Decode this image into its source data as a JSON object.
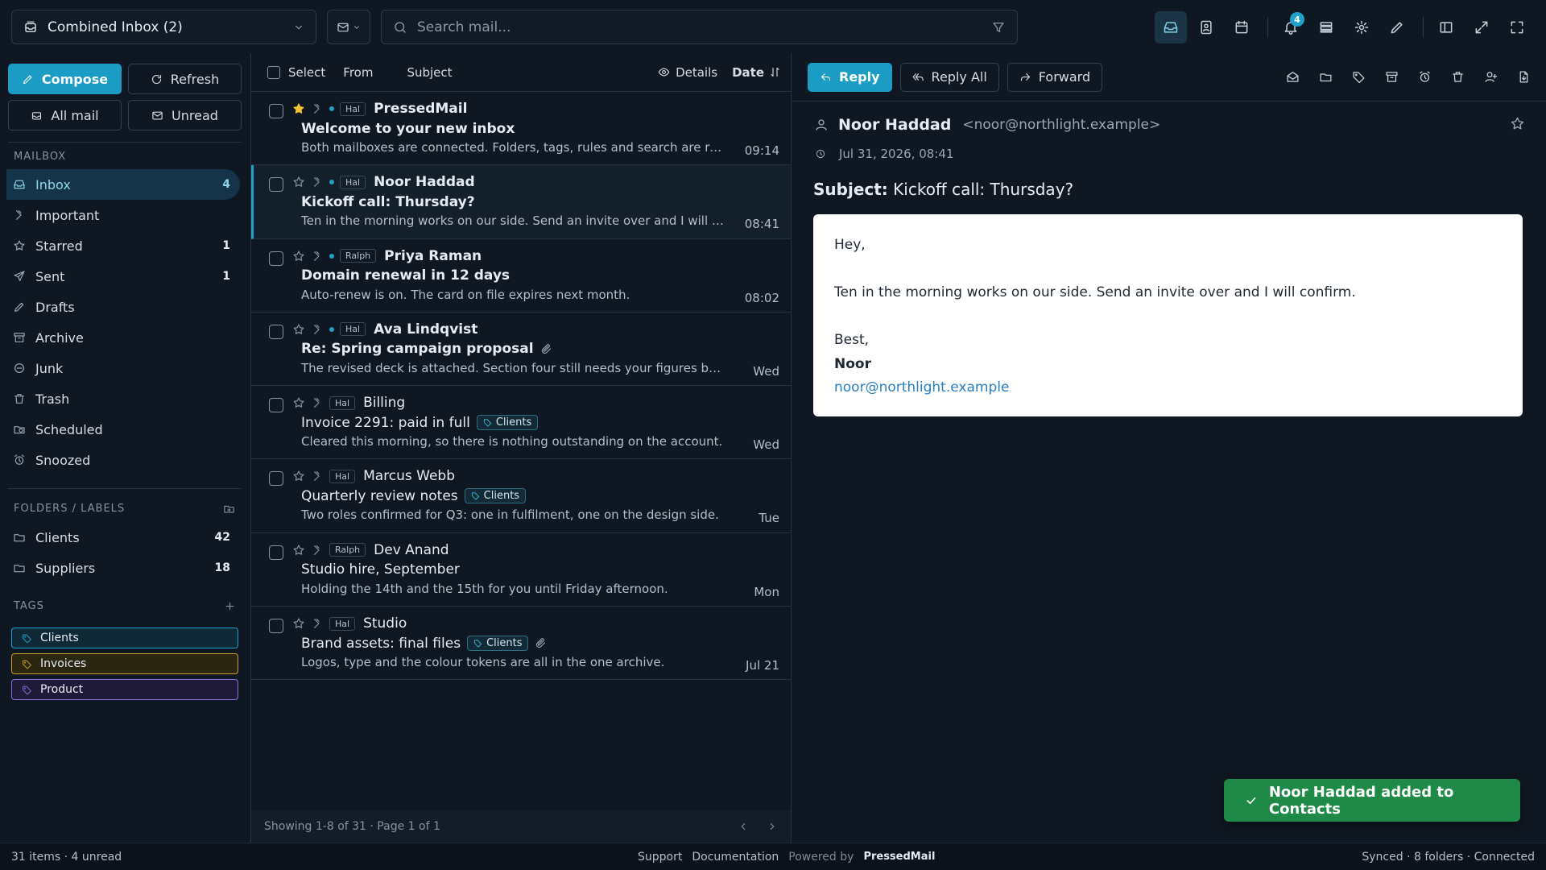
{
  "topbar": {
    "account_label": "Combined Inbox (2)",
    "search_placeholder": "Search mail...",
    "notification_count": "4"
  },
  "sidebar": {
    "compose_label": "Compose",
    "refresh_label": "Refresh",
    "all_mail_label": "All mail",
    "unread_label": "Unread",
    "mailbox_heading": "MAILBOX",
    "mailbox": [
      {
        "label": "Inbox",
        "count": "4",
        "icon": "inbox-icon"
      },
      {
        "label": "Important",
        "count": "",
        "icon": "important-icon"
      },
      {
        "label": "Starred",
        "count": "1",
        "icon": "star-icon"
      },
      {
        "label": "Sent",
        "count": "1",
        "icon": "send-icon"
      },
      {
        "label": "Drafts",
        "count": "",
        "icon": "pencil-icon"
      },
      {
        "label": "Archive",
        "count": "",
        "icon": "archive-icon"
      },
      {
        "label": "Junk",
        "count": "",
        "icon": "junk-icon"
      },
      {
        "label": "Trash",
        "count": "",
        "icon": "trash-icon"
      },
      {
        "label": "Scheduled",
        "count": "",
        "icon": "folder-clock-icon"
      },
      {
        "label": "Snoozed",
        "count": "",
        "icon": "alarm-icon"
      }
    ],
    "folders_heading": "FOLDERS / LABELS",
    "folders": [
      {
        "label": "Clients",
        "count": "42"
      },
      {
        "label": "Suppliers",
        "count": "18"
      }
    ],
    "tags_heading": "TAGS",
    "tags": [
      {
        "label": "Clients",
        "color": "#1fa2c9",
        "bg": "#0f2a36"
      },
      {
        "label": "Invoices",
        "color": "#c9a02a",
        "bg": "#2b2612"
      },
      {
        "label": "Product",
        "color": "#8b6fd8",
        "bg": "#1f1a38"
      }
    ]
  },
  "list": {
    "select_label": "Select",
    "from_label": "From",
    "subject_label": "Subject",
    "details_label": "Details",
    "date_label": "Date",
    "footer_text": "Showing 1-8 of 31 · Page 1 of 1",
    "messages": [
      {
        "starred": true,
        "unread": true,
        "selected": false,
        "account": "Hal",
        "from": "PressedMail",
        "subject": "Welcome to your new inbox",
        "tag": "",
        "attach": false,
        "preview": "Both mailboxes are connected. Folders, tags, rules and search are ready.",
        "time": "09:14"
      },
      {
        "starred": false,
        "unread": true,
        "selected": true,
        "account": "Hal",
        "from": "Noor Haddad",
        "subject": "Kickoff call: Thursday?",
        "tag": "",
        "attach": false,
        "preview": "Ten in the morning works on our side. Send an invite over and I will confirm.",
        "time": "08:41"
      },
      {
        "starred": false,
        "unread": true,
        "selected": false,
        "account": "Ralph",
        "from": "Priya Raman",
        "subject": "Domain renewal in 12 days",
        "tag": "",
        "attach": false,
        "preview": "Auto-renew is on. The card on file expires next month.",
        "time": "08:02"
      },
      {
        "starred": false,
        "unread": true,
        "selected": false,
        "account": "Hal",
        "from": "Ava Lindqvist",
        "subject": "Re: Spring campaign proposal",
        "tag": "",
        "attach": true,
        "preview": "The revised deck is attached. Section four still needs your figures before Friday.",
        "time": "Wed"
      },
      {
        "starred": false,
        "unread": false,
        "selected": false,
        "account": "Hal",
        "from": "Billing",
        "subject": "Invoice 2291: paid in full",
        "tag": "Clients",
        "attach": false,
        "preview": "Cleared this morning, so there is nothing outstanding on the account.",
        "time": "Wed"
      },
      {
        "starred": false,
        "unread": false,
        "selected": false,
        "account": "Hal",
        "from": "Marcus Webb",
        "subject": "Quarterly review notes",
        "tag": "Clients",
        "attach": false,
        "preview": "Two roles confirmed for Q3: one in fulfilment, one on the design side.",
        "time": "Tue"
      },
      {
        "starred": false,
        "unread": false,
        "selected": false,
        "account": "Ralph",
        "from": "Dev Anand",
        "subject": "Studio hire, September",
        "tag": "",
        "attach": false,
        "preview": "Holding the 14th and the 15th for you until Friday afternoon.",
        "time": "Mon"
      },
      {
        "starred": false,
        "unread": false,
        "selected": false,
        "account": "Hal",
        "from": "Studio",
        "subject": "Brand assets: final files",
        "tag": "Clients",
        "attach": true,
        "preview": "Logos, type and the colour tokens are all in the one archive.",
        "time": "Jul 21"
      }
    ]
  },
  "reader": {
    "reply_label": "Reply",
    "reply_all_label": "Reply All",
    "forward_label": "Forward",
    "sender_name": "Noor Haddad",
    "sender_addr": "<noor@northlight.example>",
    "date": "Jul 31, 2026, 08:41",
    "subject_prefix": "Subject:",
    "subject": "Kickoff call: Thursday?",
    "body": {
      "greeting": "Hey,",
      "para": "Ten in the morning works on our side. Send an invite over and I will confirm.",
      "signoff": "Best,",
      "signature_name": "Noor",
      "signature_email": "noor@northlight.example"
    }
  },
  "toast": {
    "message": "Noor Haddad added to Contacts"
  },
  "status": {
    "left": "31 items · 4 unread",
    "support": "Support",
    "documentation": "Documentation",
    "powered_by": "Powered by",
    "brand": "PressedMail",
    "right": "Synced · 8 folders · Connected"
  }
}
